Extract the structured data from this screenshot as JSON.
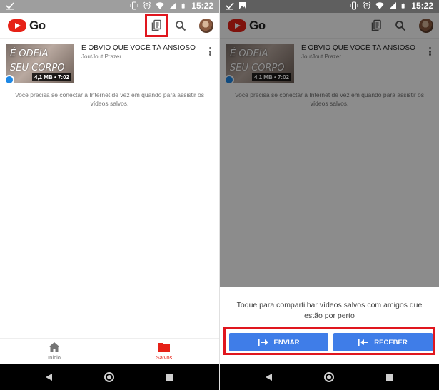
{
  "status_bar": {
    "time": "15:22"
  },
  "app": {
    "name": "Go"
  },
  "video": {
    "title": "É OBVIO QUE VOCÊ TÁ ANSIOSO",
    "channel": "JoutJout Prazer",
    "thumbnail_text_line1": "É ODEIA",
    "thumbnail_text_line2": "SEU CORPO",
    "meta": "4,1 MB • 7:02"
  },
  "offline_message": "Você precisa se conectar à Internet de vez em quando para assistir os vídeos salvos.",
  "bottom_nav": {
    "items": [
      {
        "label": "Início",
        "icon": "home-icon",
        "active": false
      },
      {
        "label": "Salvos",
        "icon": "folder-icon",
        "active": true
      }
    ]
  },
  "share_sheet": {
    "text": "Toque para compartilhar vídeos salvos com amigos que estão por perto",
    "send_label": "ENVIAR",
    "receive_label": "RECEBER"
  },
  "colors": {
    "brand_red": "#e62117",
    "highlight_red": "#e0161e",
    "button_blue": "#3f7de8"
  },
  "icons": [
    "share-icon",
    "search-icon",
    "more-vert-icon",
    "home-icon",
    "folder-icon",
    "send-icon",
    "receive-icon",
    "check-icon",
    "image-icon",
    "vibrate-icon",
    "alarm-icon",
    "wifi-icon",
    "signal-icon",
    "battery-icon"
  ]
}
